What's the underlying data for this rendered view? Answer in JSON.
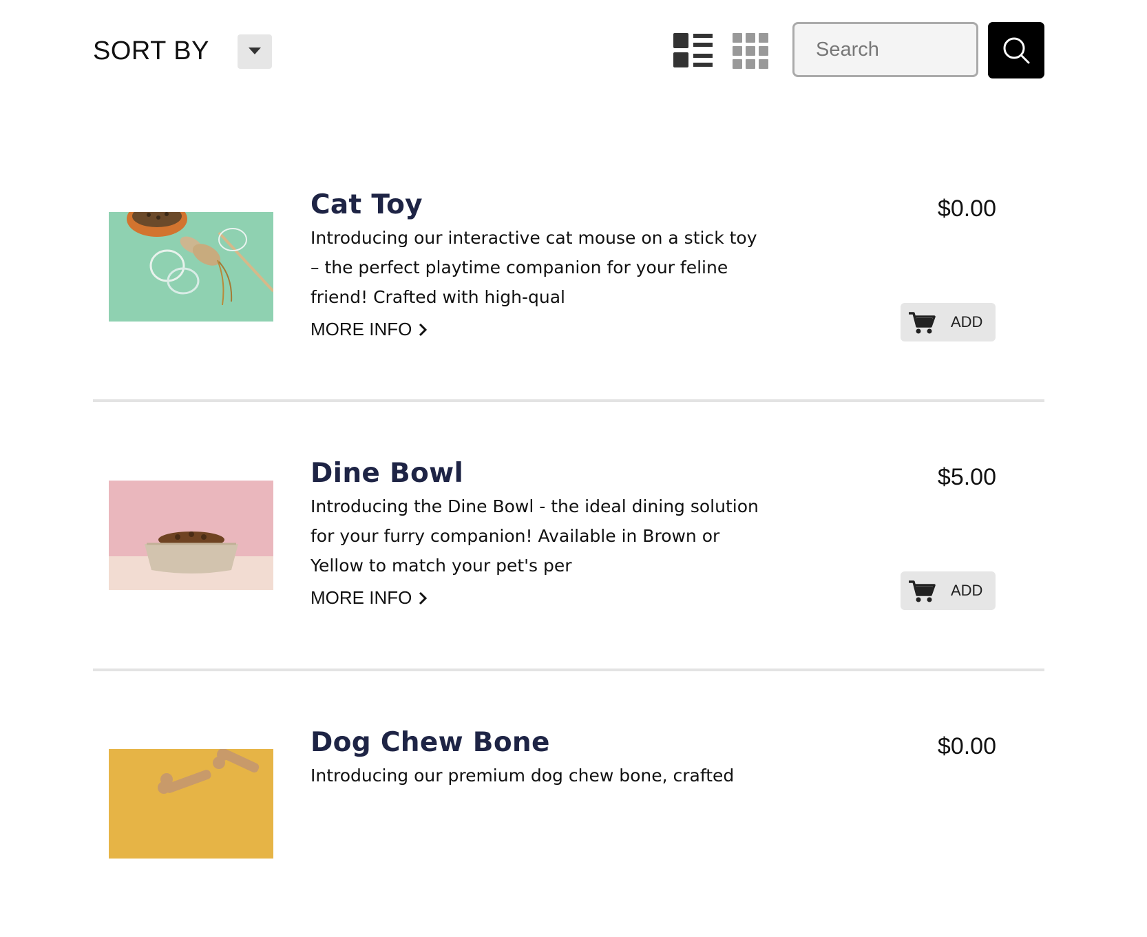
{
  "toolbar": {
    "sort_label": "SORT BY",
    "search_placeholder": "Search"
  },
  "products": [
    {
      "name": "Cat Toy",
      "description": "Introducing our interactive cat mouse on a stick toy – the perfect playtime companion for your feline friend! Crafted with high-qual",
      "more_info": "MORE INFO",
      "price": "$0.00",
      "add_label": "ADD"
    },
    {
      "name": "Dine Bowl",
      "description": "Introducing the Dine Bowl - the ideal dining solution for your furry companion! Available in Brown or Yellow to match your pet's per",
      "more_info": "MORE INFO",
      "price": "$5.00",
      "add_label": "ADD"
    },
    {
      "name": "Dog Chew Bone",
      "description": "Introducing our premium dog chew bone, crafted",
      "price": "$0.00"
    }
  ],
  "colors": {
    "title": "#1e2445",
    "search_button": "#000000",
    "add_button_bg": "#e6e6e6",
    "divider": "#e3e3e3"
  }
}
